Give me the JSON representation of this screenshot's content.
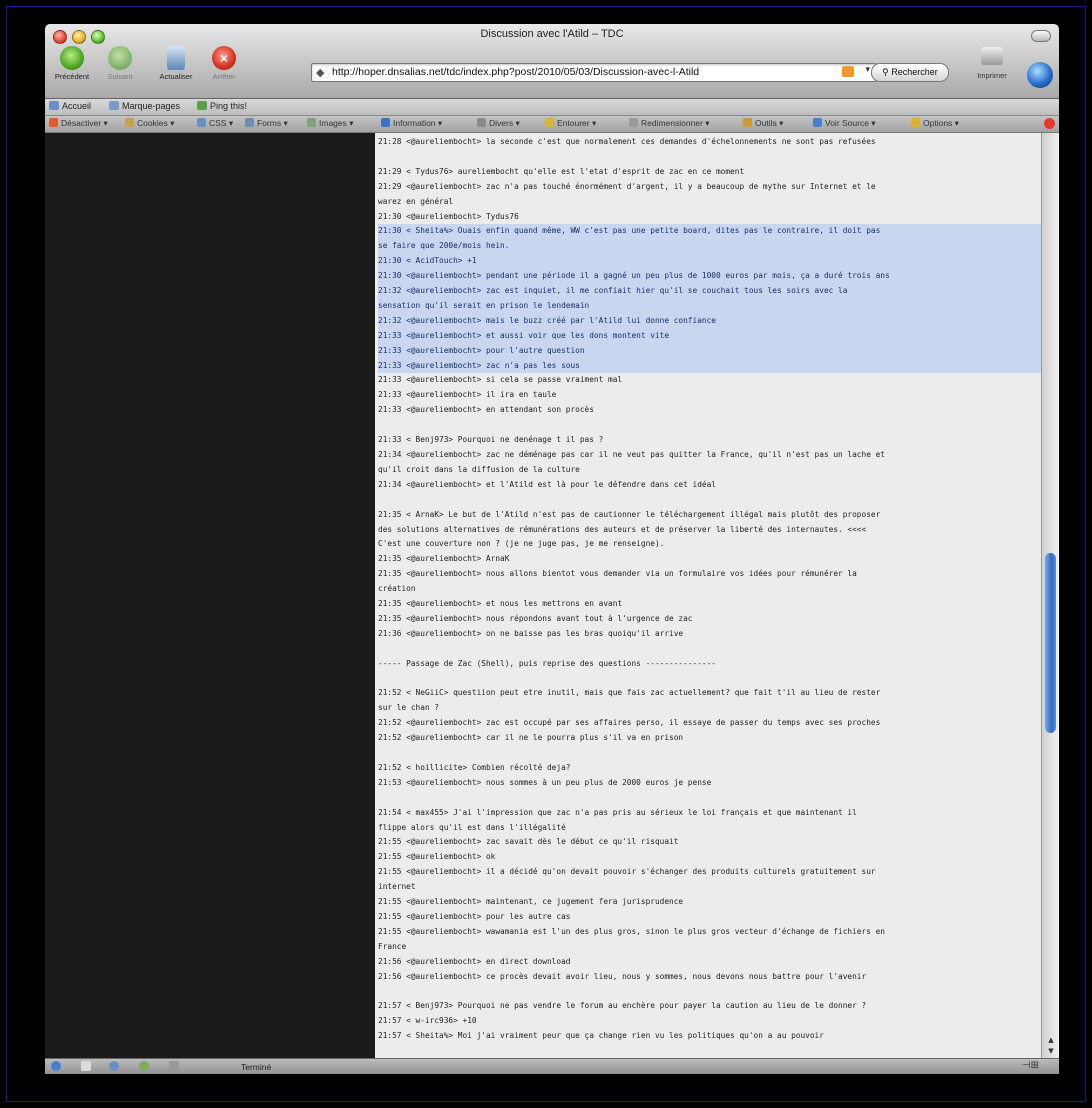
{
  "window": {
    "title": "Discussion avec l'Atild – TDC"
  },
  "toolbar": {
    "back_label": "Précédent",
    "forward_label": "Suivant",
    "reload_label": "Actualiser",
    "stop_label": "Arrêter",
    "url": "http://hoper.dnsalias.net/tdc/index.php?post/2010/05/03/Discussion-avec-l-Atild",
    "search_label": "Rechercher",
    "print_label": "Imprimer"
  },
  "bookmarks": [
    {
      "label": "Accueil",
      "icon": "home-icon"
    },
    {
      "label": "Marque-pages",
      "icon": "bookmarks-icon"
    },
    {
      "label": "Ping this!",
      "icon": "ping-icon"
    }
  ],
  "devbar": [
    {
      "label": "Désactiver ▾",
      "icon": "disable-icon",
      "color": "#e05a2a"
    },
    {
      "label": "Cookies ▾",
      "icon": "cookie-icon",
      "color": "#c8a248"
    },
    {
      "label": "CSS ▾",
      "icon": "css-icon",
      "color": "#6a8fc6"
    },
    {
      "label": "Forms ▾",
      "icon": "forms-icon",
      "color": "#6f8db3"
    },
    {
      "label": "Images ▾",
      "icon": "images-icon",
      "color": "#7fa27b"
    },
    {
      "label": "Information ▾",
      "icon": "info-icon",
      "color": "#3b73c9"
    },
    {
      "label": "Divers ▾",
      "icon": "misc-icon",
      "color": "#8a8a8a"
    },
    {
      "label": "Entourer ▾",
      "icon": "outline-icon",
      "color": "#d8b33a"
    },
    {
      "label": "Redimensionner ▾",
      "icon": "resize-icon",
      "color": "#9a9a9a"
    },
    {
      "label": "Outils ▾",
      "icon": "tools-icon",
      "color": "#c99a3a"
    },
    {
      "label": "Voir Source ▾",
      "icon": "source-icon",
      "color": "#4a7fcf"
    },
    {
      "label": "Options ▾",
      "icon": "options-icon",
      "color": "#e0b030"
    }
  ],
  "chat": [
    {
      "text": "21:28 <@aureliembocht> la seconde c'est que normalement ces demandes d'échelonnements ne sont pas refusées",
      "hl": false
    },
    {
      "text": "",
      "hl": false
    },
    {
      "text": "21:29 < Tydus76> aureliembocht qu'elle est l'etat d'esprit de zac en ce moment",
      "hl": false
    },
    {
      "text": "21:29 <@aureliembocht> zac n'a pas touché énormément d'argent, il y a beaucoup de mythe sur Internet et le",
      "hl": false
    },
    {
      "text": "warez en général",
      "hl": false
    },
    {
      "text": "21:30 <@aureliembocht> Tydus76",
      "hl": false
    },
    {
      "text": "21:30 < Sheita%> Ouais enfin quand même, WW c'est pas une petite board, dites pas le contraire, il doit pas",
      "hl": true
    },
    {
      "text": "se faire que 200e/mois hein.",
      "hl": true
    },
    {
      "text": "21:30 < AcidTouch> +1",
      "hl": true
    },
    {
      "text": "21:30 <@aureliembocht> pendant une période il a gagné un peu plus de 1000 euros par mois, ça a duré trois ans",
      "hl": true
    },
    {
      "text": "21:32 <@aureliembocht> zac est inquiet, il me confiait hier qu'il se couchait tous les soirs avec la",
      "hl": true
    },
    {
      "text": "sensation qu'il serait en prison le lendemain",
      "hl": true
    },
    {
      "text": "21:32 <@aureliembocht> mais le buzz créé par l'Atild lui donne confiance",
      "hl": true
    },
    {
      "text": "21:33 <@aureliembocht> et aussi voir que les dons montent vite",
      "hl": true
    },
    {
      "text": "21:33 <@aureliembocht> pour l'autre question",
      "hl": true
    },
    {
      "text": "21:33 <@aureliembocht> zac n'a pas les sous",
      "hl": true
    },
    {
      "text": "21:33 <@aureliembocht> si cela se passe vraiment mal",
      "hl": false
    },
    {
      "text": "21:33 <@aureliembocht> il ira en taule",
      "hl": false
    },
    {
      "text": "21:33 <@aureliembocht> en attendant son procès",
      "hl": false
    },
    {
      "text": "",
      "hl": false
    },
    {
      "text": "21:33 < Benj973> Pourquoi ne denénage t il pas ?",
      "hl": false
    },
    {
      "text": "21:34 <@aureliembocht> zac ne déménage pas car il ne veut pas quitter la France, qu'il n'est pas un lache et",
      "hl": false
    },
    {
      "text": "qu'il croit dans la diffusion de la culture",
      "hl": false
    },
    {
      "text": "21:34 <@aureliembocht> et l'Atild est là pour le défendre dans cet idéal",
      "hl": false
    },
    {
      "text": "",
      "hl": false
    },
    {
      "text": "21:35 < ArnaK> Le but de l'Atild n'est pas de cautionner le téléchargement illégal mais plutôt des proposer",
      "hl": false
    },
    {
      "text": "des solutions alternatives de rémunérations des auteurs et de préserver la liberté des internautes. <<<<",
      "hl": false
    },
    {
      "text": "C'est une couverture non ? (je ne juge pas, je me renseigne).",
      "hl": false
    },
    {
      "text": "21:35 <@aureliembocht> ArnaK",
      "hl": false
    },
    {
      "text": "21:35 <@aureliembocht> nous allons bientot vous demander via un formulaire vos idées pour rémunérer la",
      "hl": false
    },
    {
      "text": "création",
      "hl": false
    },
    {
      "text": "21:35 <@aureliembocht> et nous les mettrons en avant",
      "hl": false
    },
    {
      "text": "21:35 <@aureliembocht> nous répondons avant tout à l'urgence de zac",
      "hl": false
    },
    {
      "text": "21:36 <@aureliembocht> on ne baisse pas les bras quoiqu'il arrive",
      "hl": false
    },
    {
      "text": "",
      "hl": false
    },
    {
      "text": "----- Passage de Zac (Shell), puis reprise des questions ---------------",
      "hl": false
    },
    {
      "text": "",
      "hl": false
    },
    {
      "text": "21:52 < NeGiiC> questiion peut etre inutil, mais que fais zac actuellement? que fait t'il au lieu de rester",
      "hl": false
    },
    {
      "text": "sur le chan ?",
      "hl": false
    },
    {
      "text": "21:52 <@aureliembocht> zac est occupé par ses affaires perso, il essaye de passer du temps avec ses proches",
      "hl": false
    },
    {
      "text": "21:52 <@aureliembocht> car il ne le pourra plus s'il va en prison",
      "hl": false
    },
    {
      "text": "",
      "hl": false
    },
    {
      "text": "21:52 < hoillicite> Combien récolté deja?",
      "hl": false
    },
    {
      "text": "21:53 <@aureliembocht> nous sommes à un peu plus de 2000 euros je pense",
      "hl": false
    },
    {
      "text": "",
      "hl": false
    },
    {
      "text": "21:54 < max455> J'ai l'impression que zac n'a pas pris au sérieux le loi français et que maintenant il",
      "hl": false
    },
    {
      "text": "flippe alors qu'il est dans l'illégalité",
      "hl": false
    },
    {
      "text": "21:55 <@aureliembocht> zac savait dès le début ce qu'il risquait",
      "hl": false
    },
    {
      "text": "21:55 <@aureliembocht> ok",
      "hl": false
    },
    {
      "text": "21:55 <@aureliembocht> il a décidé qu'on devait pouvoir s'échanger des produits culturels gratuitement sur",
      "hl": false
    },
    {
      "text": "internet",
      "hl": false
    },
    {
      "text": "21:55 <@aureliembocht> maintenant, ce jugement fera jurisprudence",
      "hl": false
    },
    {
      "text": "21:55 <@aureliembocht> pour les autre cas",
      "hl": false
    },
    {
      "text": "21:55 <@aureliembocht> wawamania est l'un des plus gros, sinon le plus gros vecteur d'échange de fichiers en",
      "hl": false
    },
    {
      "text": "France",
      "hl": false
    },
    {
      "text": "21:56 <@aureliembocht> en direct download",
      "hl": false
    },
    {
      "text": "21:56 <@aureliembocht> ce procès devait avoir lieu, nous y sommes, nous devons nous battre pour l'avenir",
      "hl": false
    },
    {
      "text": "",
      "hl": false
    },
    {
      "text": "21:57 < Benj973> Pourquoi ne pas vendre le forum au enchère pour payer la caution au lieu de le donner ?",
      "hl": false
    },
    {
      "text": "21:57 < w-irc936> +10",
      "hl": false
    },
    {
      "text": "21:57 < Sheita%> Moi j'ai vraiment peur que ça change rien vu les politiques qu'on a au pouvoir",
      "hl": false
    }
  ],
  "status": {
    "text": "Terminé"
  }
}
